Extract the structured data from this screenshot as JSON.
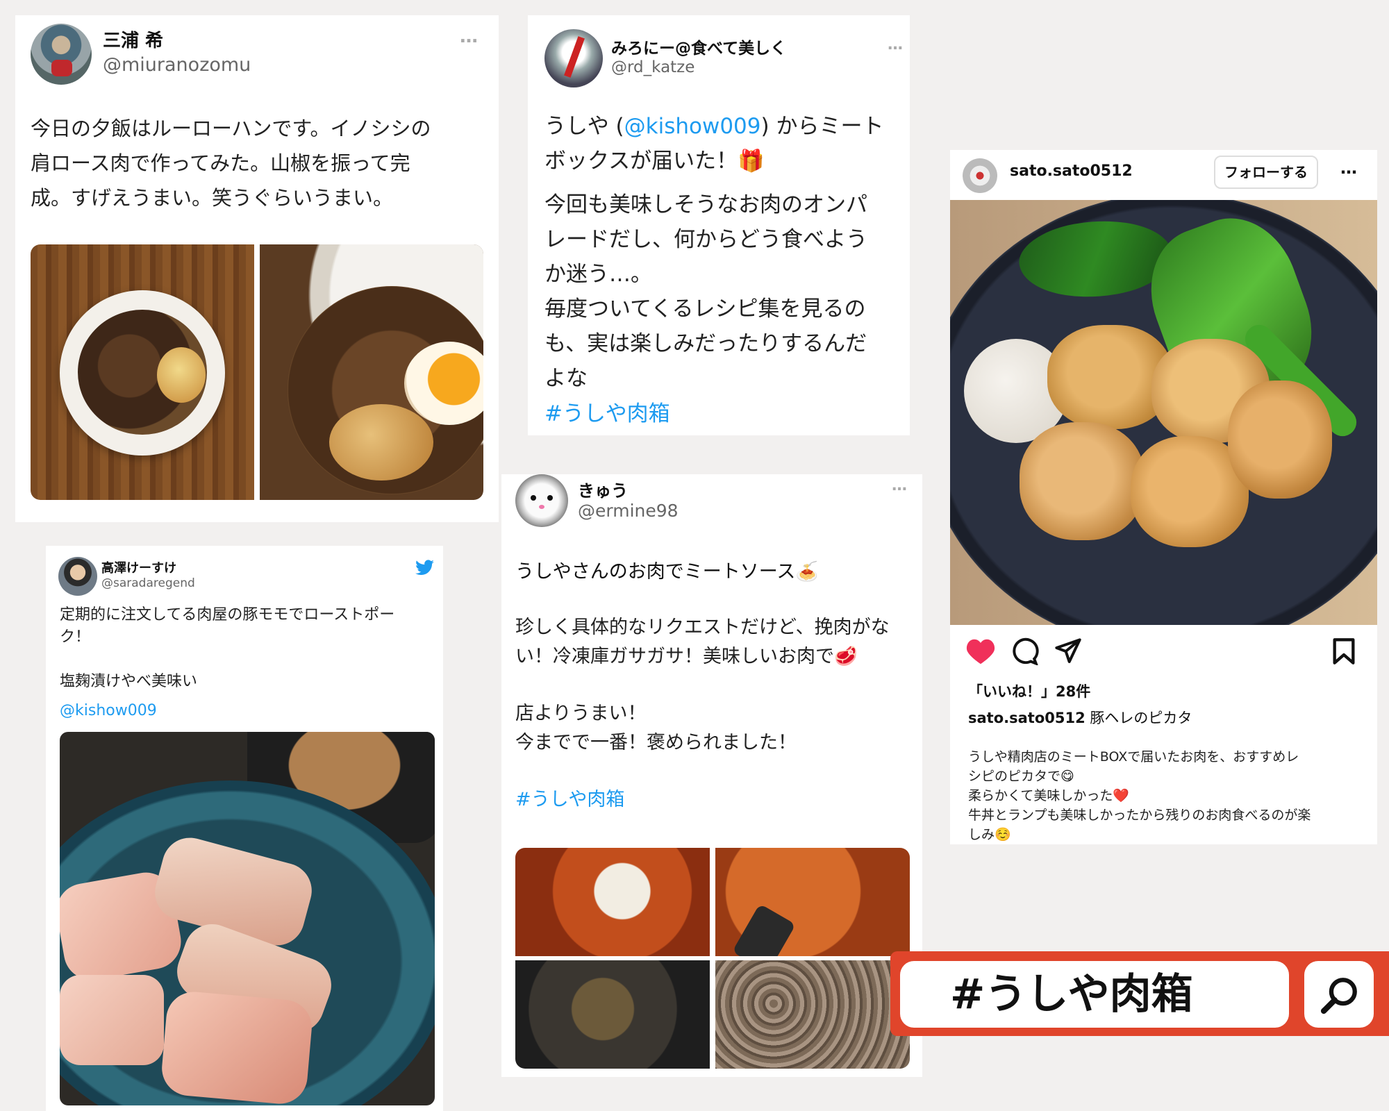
{
  "post1": {
    "name": "三浦 希",
    "handle": "@miuranozomu",
    "more": "…",
    "text": "今日の夕飯はルーローハンです。イノシシの\n肩ロース肉で作ってみた。山椒を振って完\n成。すげえうまい。笑うぐらいうまい。"
  },
  "post2": {
    "name": "みろにー@食べて美しく",
    "handle": "@rd_katze",
    "more": "…",
    "text_prefix": "うしや (",
    "mention": "@kishow009",
    "text_suffix": ") からミート\nボックスが届いた！",
    "gift_emoji": "🎁",
    "text2": "今回も美味しそうなお肉のオンパ\nレードだし、何からどう食べよう\nか迷う…。\n毎度ついてくるレシピ集を見るの\nも、実は楽しみだったりするんだ\nよな",
    "hashtag": "#うしや肉箱"
  },
  "post3": {
    "name": "高澤けーすけ",
    "handle": "@saradaregend",
    "text": "定期的に注文してる肉屋の豚モモでローストポー\nク！\n\n塩麹漬けやべ美味い",
    "mention": "@kishow009"
  },
  "post4": {
    "name": "きゅう",
    "handle": "@ermine98",
    "more": "…",
    "line1": "うしやさんのお肉でミートソース",
    "emoji1": "🍝",
    "line2": "珍しく具体的なリクエストだけど、挽肉がな\nい！冷凍庫ガサガサ！美味しいお肉で",
    "emoji2": "🥩",
    "line3": "店よりうまい！\n今までで一番！褒められました！",
    "hashtag": "#うしや肉箱"
  },
  "post5": {
    "username": "sato.sato0512",
    "follow_label": "フォローする",
    "more": "…",
    "likes": "「いいね！」28件",
    "caption_user": "sato.sato0512",
    "caption_title": "豚ヘレのピカタ",
    "caption": "うしや精肉店のミートBOXで届いたお肉を、おすすめレ\nシピのピカタで😋\n柔らかくて美味しかった❤️\n牛丼とランプも美味しかったから残りのお肉食べるのが楽\nしみ☺️"
  },
  "search": {
    "query": "#うしや肉箱"
  },
  "colors": {
    "twitter_blue": "#1d9bf0",
    "search_red": "#e0452b",
    "like_red": "#f0305a"
  },
  "icons": [
    "more-icon",
    "twitter-bird-icon",
    "heart-icon",
    "comment-icon",
    "share-icon",
    "bookmark-icon",
    "search-icon"
  ]
}
